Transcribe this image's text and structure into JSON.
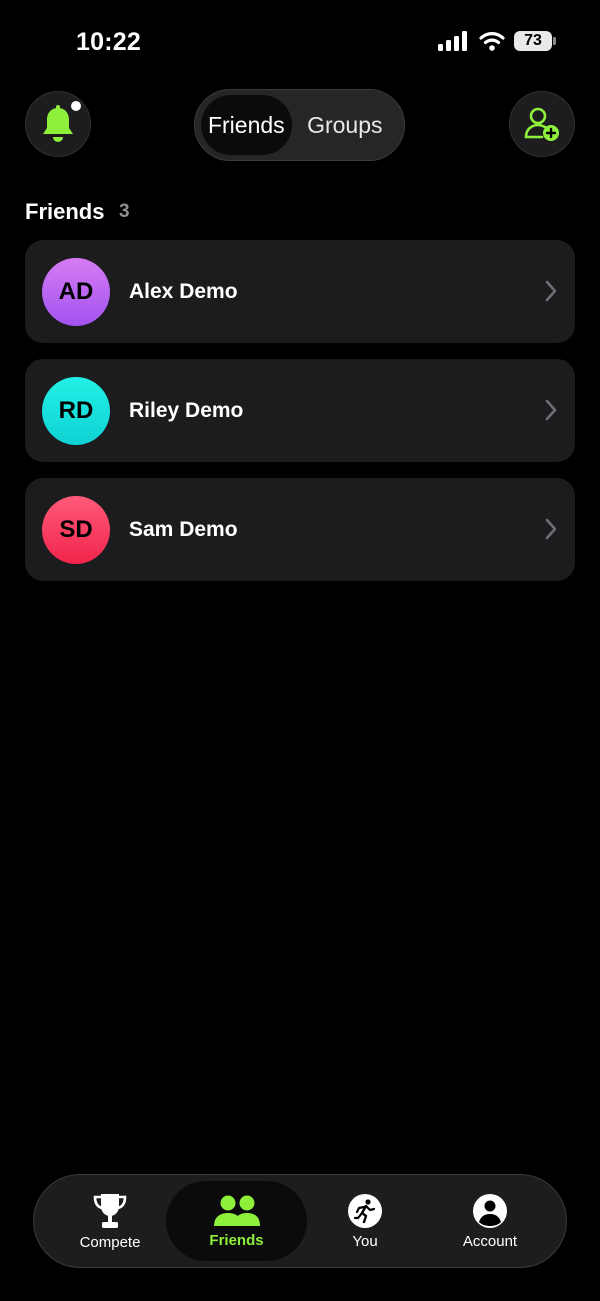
{
  "status_bar": {
    "time": "10:22",
    "battery": "73"
  },
  "header": {
    "segments": [
      {
        "label": "Friends",
        "active": true
      },
      {
        "label": "Groups",
        "active": false
      }
    ],
    "bell_icon": "bell-icon",
    "add_friend_icon": "person-add-icon"
  },
  "section": {
    "title": "Friends",
    "count": "3"
  },
  "friends": [
    {
      "initials": "AD",
      "name": "Alex Demo",
      "color_top": "#d57cf3",
      "color_bottom": "#a352f0"
    },
    {
      "initials": "RD",
      "name": "Riley Demo",
      "color_top": "#23f0e6",
      "color_bottom": "#10d2d4"
    },
    {
      "initials": "SD",
      "name": "Sam Demo",
      "color_top": "#ff5a7a",
      "color_bottom": "#f2244b"
    }
  ],
  "tabs": [
    {
      "label": "Compete",
      "icon": "trophy-icon",
      "active": false
    },
    {
      "label": "Friends",
      "icon": "people-icon",
      "active": true
    },
    {
      "label": "You",
      "icon": "runner-icon",
      "active": false
    },
    {
      "label": "Account",
      "icon": "account-icon",
      "active": false
    }
  ],
  "colors": {
    "accent": "#8ef03a",
    "background": "#000000",
    "card": "#1c1c1e"
  }
}
